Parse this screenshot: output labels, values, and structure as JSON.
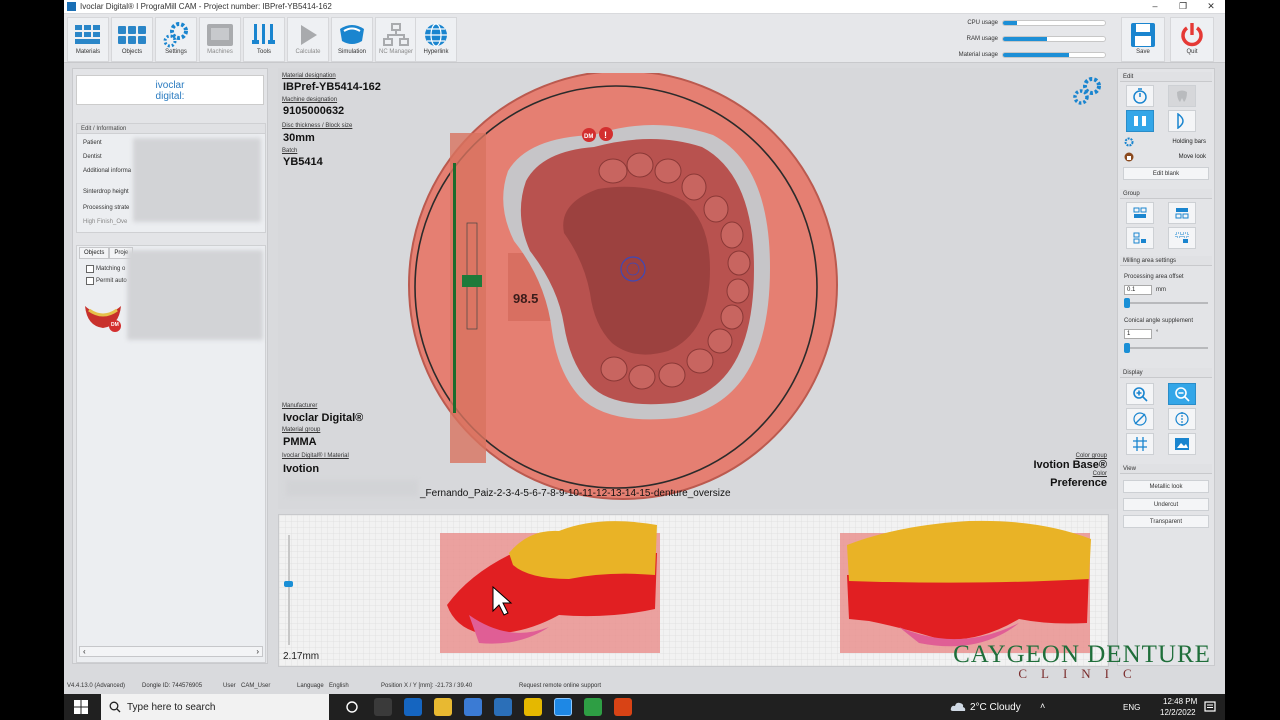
{
  "window": {
    "title": "Ivoclar Digital®  I  PrograMill CAM - Project number: IBPref-YB5414-162",
    "minimize": "–",
    "maximize": "❐",
    "close": "✕"
  },
  "toolbar": {
    "buttons": [
      {
        "label": "Materials",
        "icon": "materials-icon"
      },
      {
        "label": "Objects",
        "icon": "objects-icon"
      },
      {
        "label": "Settings",
        "icon": "gear-icon"
      },
      {
        "label": "Machines",
        "icon": "machine-icon"
      },
      {
        "label": "Tools",
        "icon": "tools-icon"
      },
      {
        "label": "Calculate",
        "icon": "play-icon"
      },
      {
        "label": "Simulation",
        "icon": "simulation-icon"
      },
      {
        "label": "NC Manager",
        "icon": "nc-manager-icon"
      },
      {
        "label": "Hyperlink",
        "icon": "globe-icon"
      }
    ],
    "usage": [
      {
        "label": "CPU usage",
        "percent": 14
      },
      {
        "label": "RAM usage",
        "percent": 43
      },
      {
        "label": "Material usage",
        "percent": 65
      }
    ],
    "save_label": "Save",
    "quit_label": "Quit"
  },
  "left": {
    "logo_line1": "ivoclar",
    "logo_line2": "digital:",
    "edit_info_header": "Edit / Information",
    "fields": [
      "Patient",
      "Dentist",
      "Additional informa",
      "Sinterdrop height",
      "Processing strate"
    ],
    "processing_value": "High Finish_Ove",
    "tabs": [
      "Objects",
      "Proje"
    ],
    "checkboxes": [
      "Matching o",
      "Permit auto"
    ],
    "object_badge": "DM",
    "scroll_left": "‹",
    "scroll_right": "›"
  },
  "viewport": {
    "material_designation_label": "Material designation",
    "material_designation": "IBPref-YB5414-162",
    "machine_designation_label": "Machine designation",
    "machine_designation": "9105000632",
    "disc_label": "Disc thickness / Block size",
    "disc_value": "30mm",
    "batch_label": "Batch",
    "batch_value": "YB5414",
    "manufacturer_label": "Manufacturer",
    "manufacturer": "Ivoclar Digital®",
    "material_group_label": "Material group",
    "material_group": "PMMA",
    "material_label": "Ivoclar Digital®  I  Material",
    "material": "Ivotion",
    "color_group_label": "Color group",
    "color_group": "Ivotion Base®",
    "color_label": "Color",
    "color": "Preference",
    "filename": "_Fernando_Paiz-2-3-4-5-6-7-8-9-10-11-12-13-14-15-denture_oversize",
    "disc_overlay_value": "98.5",
    "dm_badge": "DM",
    "warning_badge": "!"
  },
  "bottom": {
    "thickness": "2.17mm"
  },
  "right": {
    "edit_header": "Edit",
    "holding_bars": "Holding bars",
    "move_look": "Move look",
    "edit_blank": "Edit blank",
    "group_header": "Group",
    "milling_header": "Milling area settings",
    "processing_offset_label": "Processing area offset",
    "processing_offset_value": "0.1",
    "processing_offset_unit": "mm",
    "conical_label": "Conical angle supplement",
    "conical_value": "1",
    "conical_unit": "°",
    "display_header": "Display",
    "view_header": "View",
    "metallic_look": "Metallic look",
    "undercut": "Undercut",
    "transparent": "Transparent"
  },
  "status": {
    "version": "V4.4.13.0 (Advanced)",
    "dongle": "Dongle ID: 744576905",
    "user_label": "User",
    "user": "CAM_User",
    "language_label": "Language",
    "language": "English",
    "position": "Position X / Y [mm]: -21.73 / 39.40",
    "support": "Request remote online support"
  },
  "taskbar": {
    "search_placeholder": "Type here to search",
    "weather": "2°C  Cloudy",
    "lang": "ENG",
    "time": "12:48 PM",
    "date": "12/2/2022"
  },
  "watermark": {
    "line1": "CAYGEON DENTURE",
    "line2": "CLINIC"
  },
  "colors": {
    "accent": "#1d8fd6",
    "disc": "#e57f72",
    "denture": "#b8524f",
    "quit": "#e53935"
  }
}
